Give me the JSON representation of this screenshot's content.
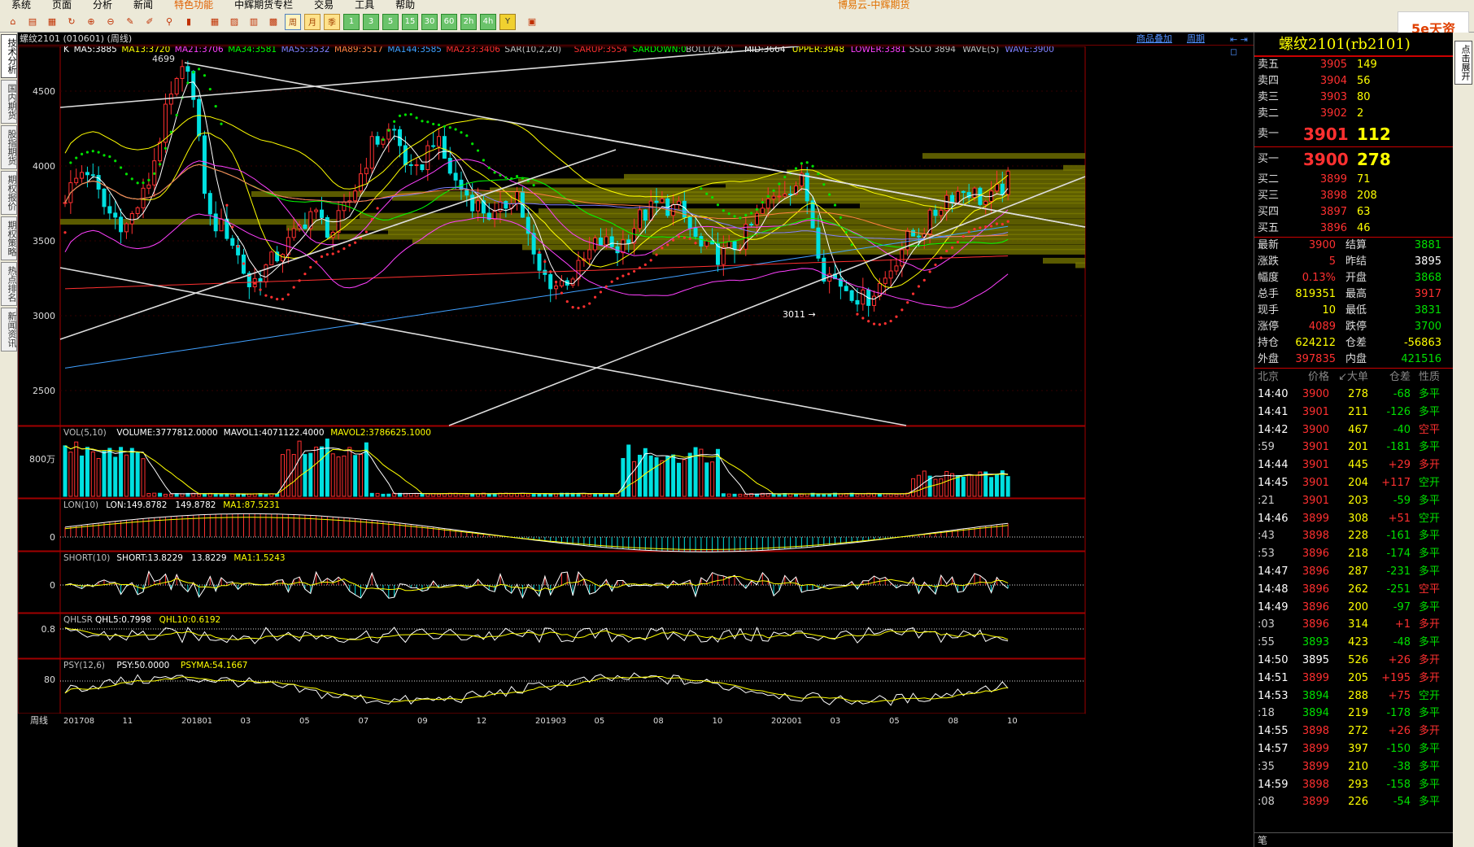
{
  "menu": {
    "items": [
      "系统",
      "页面",
      "分析",
      "新闻",
      "特色功能",
      "中辉期货专栏",
      "交易",
      "工具",
      "帮助"
    ],
    "highlight_index": 4,
    "app_title": "博易云-中辉期货"
  },
  "toolbar": {
    "period_buttons": [
      "周",
      "月",
      "季",
      "1",
      "3",
      "5",
      "15",
      "30",
      "60",
      "2h",
      "4h",
      "Y"
    ],
    "selected_period": "周"
  },
  "logo_text": "5e天资",
  "left_tabs": [
    "技术分析",
    "国内期货",
    "股指期货",
    "期权报价",
    "期权策略",
    "热点排名",
    "新闻资讯"
  ],
  "chart_header": {
    "title": "螺纹2101 (010601) (周线)",
    "overlay_link": "商品叠加",
    "period_link": "周期"
  },
  "main_indicators": [
    {
      "text": "K",
      "color": "#ffffff"
    },
    {
      "text": "MA5:3885",
      "color": "#ffffff"
    },
    {
      "text": "MA13:3720",
      "color": "#ffff00"
    },
    {
      "text": "MA21:3706",
      "color": "#ff40ff"
    },
    {
      "text": "MA34:3581",
      "color": "#00ff00"
    },
    {
      "text": "MA55:3532",
      "color": "#8080ff"
    },
    {
      "text": "MA89:3517",
      "color": "#ff8040"
    },
    {
      "text": "MA144:3585",
      "color": "#40a0ff"
    },
    {
      "text": "MA233:3406",
      "color": "#ff3030"
    },
    {
      "text": "SAR(10,2,20)",
      "color": "#c0c0c0"
    },
    {
      "text": "SARUP:3554",
      "color": "#ff3030"
    },
    {
      "text": "SARDOWN:0",
      "color": "#00ff00"
    },
    {
      "text": "BOLL(26,2)",
      "color": "#c0c0c0"
    },
    {
      "text": "MID:3664",
      "color": "#ffffff"
    },
    {
      "text": "UPPER:3948",
      "color": "#ffff00"
    },
    {
      "text": "LOWER:3381",
      "color": "#ff40ff"
    },
    {
      "text": "SSLO 3894",
      "color": "#c0c0c0"
    },
    {
      "text": "WAVE(5)",
      "color": "#c0c0c0"
    },
    {
      "text": "WAVE:3900",
      "color": "#8080ff"
    }
  ],
  "price_axis": [
    "4500",
    "4000",
    "3500",
    "3000",
    "2500"
  ],
  "annotations": {
    "high": "4699",
    "low": "3011"
  },
  "sub_panels": {
    "vol": {
      "items": [
        {
          "text": "VOL(5,10)",
          "color": "#c0c0c0"
        },
        {
          "text": "VOLUME:3777812.0000",
          "color": "#ffffff"
        },
        {
          "text": "MAVOL1:4071122.4000",
          "color": "#ffffff"
        },
        {
          "text": "MAVOL2:3786625.1000",
          "color": "#ffff00"
        }
      ],
      "axis": "800万"
    },
    "lon": {
      "items": [
        {
          "text": "LON(10)",
          "color": "#c0c0c0"
        },
        {
          "text": "LON:149.8782",
          "color": "#ffffff"
        },
        {
          "text": "149.8782",
          "color": "#ffffff"
        },
        {
          "text": "MA1:87.5231",
          "color": "#ffff00"
        }
      ],
      "axis": "0"
    },
    "short": {
      "items": [
        {
          "text": "SHORT(10)",
          "color": "#c0c0c0"
        },
        {
          "text": "SHORT:13.8229",
          "color": "#ffffff"
        },
        {
          "text": "13.8229",
          "color": "#ffffff"
        },
        {
          "text": "MA1:1.5243",
          "color": "#ffff00"
        }
      ],
      "axis": "0"
    },
    "qhlsr": {
      "items": [
        {
          "text": "QHLSR",
          "color": "#c0c0c0"
        },
        {
          "text": "QHL5:0.7998",
          "color": "#ffffff"
        },
        {
          "text": "QHL10:0.6192",
          "color": "#ffff00"
        }
      ],
      "axis": "0.8"
    },
    "psy": {
      "items": [
        {
          "text": "PSY(12,6)",
          "color": "#c0c0c0"
        },
        {
          "text": "PSY:50.0000",
          "color": "#ffffff"
        },
        {
          "text": "PSYMA:54.1667",
          "color": "#ffff00"
        }
      ],
      "axis": "80"
    }
  },
  "time_axis": {
    "label": "周线",
    "ticks": [
      "201708",
      "11",
      "201801",
      "03",
      "05",
      "07",
      "09",
      "12",
      "201903",
      "05",
      "08",
      "10",
      "202001",
      "03",
      "05",
      "08",
      "10"
    ]
  },
  "quote": {
    "title": "螺纹2101(rb2101)",
    "asks": [
      {
        "label": "卖五",
        "price": "3905",
        "vol": "149"
      },
      {
        "label": "卖四",
        "price": "3904",
        "vol": "56"
      },
      {
        "label": "卖三",
        "price": "3903",
        "vol": "80"
      },
      {
        "label": "卖二",
        "price": "3902",
        "vol": "2"
      },
      {
        "label": "卖一",
        "price": "3901",
        "vol": "112"
      }
    ],
    "bids": [
      {
        "label": "买一",
        "price": "3900",
        "vol": "278"
      },
      {
        "label": "买二",
        "price": "3899",
        "vol": "71"
      },
      {
        "label": "买三",
        "price": "3898",
        "vol": "208"
      },
      {
        "label": "买四",
        "price": "3897",
        "vol": "63"
      },
      {
        "label": "买五",
        "price": "3896",
        "vol": "46"
      }
    ],
    "stats": [
      {
        "k1": "最新",
        "v1": "3900",
        "c1": "red",
        "k2": "结算",
        "v2": "3881",
        "c2": "grn"
      },
      {
        "k1": "涨跌",
        "v1": "5",
        "c1": "red",
        "k2": "昨结",
        "v2": "3895",
        "c2": "wht"
      },
      {
        "k1": "幅度",
        "v1": "0.13%",
        "c1": "red",
        "k2": "开盘",
        "v2": "3868",
        "c2": "grn"
      },
      {
        "k1": "总手",
        "v1": "819351",
        "c1": "yel",
        "k2": "最高",
        "v2": "3917",
        "c2": "red"
      },
      {
        "k1": "现手",
        "v1": "10",
        "c1": "yel",
        "k2": "最低",
        "v2": "3831",
        "c2": "grn"
      },
      {
        "k1": "涨停",
        "v1": "4089",
        "c1": "red",
        "k2": "跌停",
        "v2": "3700",
        "c2": "grn"
      },
      {
        "k1": "持仓",
        "v1": "624212",
        "c1": "yel",
        "k2": "仓差",
        "v2": "-56863",
        "c2": "yel"
      },
      {
        "k1": "外盘",
        "v1": "397835",
        "c1": "red",
        "k2": "内盘",
        "v2": "421516",
        "c2": "grn"
      }
    ],
    "tick_header": [
      "北京",
      "价格",
      "↙大单",
      "仓差",
      "性质"
    ],
    "ticks": [
      {
        "t": "14:40",
        "p": "3900",
        "v": "278",
        "o": "-68",
        "ty": "多平",
        "pc": "red",
        "oc": "grn",
        "tc": "grn",
        "small": false
      },
      {
        "t": "14:41",
        "p": "3901",
        "v": "211",
        "o": "-126",
        "ty": "多平",
        "pc": "red",
        "oc": "grn",
        "tc": "grn",
        "small": false
      },
      {
        "t": "14:42",
        "p": "3900",
        "v": "467",
        "o": "-40",
        "ty": "空平",
        "pc": "red",
        "oc": "grn",
        "tc": "red",
        "small": false
      },
      {
        "t": ":59",
        "p": "3901",
        "v": "201",
        "o": "-181",
        "ty": "多平",
        "pc": "red",
        "oc": "grn",
        "tc": "grn",
        "small": true
      },
      {
        "t": "14:44",
        "p": "3901",
        "v": "445",
        "o": "+29",
        "ty": "多开",
        "pc": "red",
        "oc": "red",
        "tc": "red",
        "small": false
      },
      {
        "t": "14:45",
        "p": "3901",
        "v": "204",
        "o": "+117",
        "ty": "空开",
        "pc": "red",
        "oc": "red",
        "tc": "grn",
        "small": false
      },
      {
        "t": ":21",
        "p": "3901",
        "v": "203",
        "o": "-59",
        "ty": "多平",
        "pc": "red",
        "oc": "grn",
        "tc": "grn",
        "small": true
      },
      {
        "t": "14:46",
        "p": "3899",
        "v": "308",
        "o": "+51",
        "ty": "空开",
        "pc": "red",
        "oc": "red",
        "tc": "grn",
        "small": false
      },
      {
        "t": ":43",
        "p": "3898",
        "v": "228",
        "o": "-161",
        "ty": "多平",
        "pc": "red",
        "oc": "grn",
        "tc": "grn",
        "small": true
      },
      {
        "t": ":53",
        "p": "3896",
        "v": "218",
        "o": "-174",
        "ty": "多平",
        "pc": "red",
        "oc": "grn",
        "tc": "grn",
        "small": true
      },
      {
        "t": "14:47",
        "p": "3896",
        "v": "287",
        "o": "-231",
        "ty": "多平",
        "pc": "red",
        "oc": "grn",
        "tc": "grn",
        "small": false
      },
      {
        "t": "14:48",
        "p": "3896",
        "v": "262",
        "o": "-251",
        "ty": "空平",
        "pc": "red",
        "oc": "grn",
        "tc": "red",
        "small": false
      },
      {
        "t": "14:49",
        "p": "3896",
        "v": "200",
        "o": "-97",
        "ty": "多平",
        "pc": "red",
        "oc": "grn",
        "tc": "grn",
        "small": false
      },
      {
        "t": ":03",
        "p": "3896",
        "v": "314",
        "o": "+1",
        "ty": "多开",
        "pc": "red",
        "oc": "red",
        "tc": "red",
        "small": true
      },
      {
        "t": ":55",
        "p": "3893",
        "v": "423",
        "o": "-48",
        "ty": "多平",
        "pc": "grn",
        "oc": "grn",
        "tc": "grn",
        "small": true
      },
      {
        "t": "14:50",
        "p": "3895",
        "v": "526",
        "o": "+26",
        "ty": "多开",
        "pc": "wht",
        "oc": "red",
        "tc": "red",
        "small": false
      },
      {
        "t": "14:51",
        "p": "3899",
        "v": "205",
        "o": "+195",
        "ty": "多开",
        "pc": "red",
        "oc": "red",
        "tc": "red",
        "small": false
      },
      {
        "t": "14:53",
        "p": "3894",
        "v": "288",
        "o": "+75",
        "ty": "空开",
        "pc": "grn",
        "oc": "red",
        "tc": "grn",
        "small": false
      },
      {
        "t": ":18",
        "p": "3894",
        "v": "219",
        "o": "-178",
        "ty": "多平",
        "pc": "grn",
        "oc": "grn",
        "tc": "grn",
        "small": true
      },
      {
        "t": "14:55",
        "p": "3898",
        "v": "272",
        "o": "+26",
        "ty": "多开",
        "pc": "red",
        "oc": "red",
        "tc": "red",
        "small": false
      },
      {
        "t": "14:57",
        "p": "3899",
        "v": "397",
        "o": "-150",
        "ty": "多平",
        "pc": "red",
        "oc": "grn",
        "tc": "grn",
        "small": false
      },
      {
        "t": ":35",
        "p": "3899",
        "v": "210",
        "o": "-38",
        "ty": "多平",
        "pc": "red",
        "oc": "grn",
        "tc": "grn",
        "small": true
      },
      {
        "t": "14:59",
        "p": "3898",
        "v": "293",
        "o": "-158",
        "ty": "多平",
        "pc": "red",
        "oc": "grn",
        "tc": "grn",
        "small": false
      },
      {
        "t": ":08",
        "p": "3899",
        "v": "226",
        "o": "-54",
        "ty": "多平",
        "pc": "red",
        "oc": "grn",
        "tc": "grn",
        "small": true
      }
    ],
    "footer": "笔"
  },
  "far_right_tab": "点击展开"
}
